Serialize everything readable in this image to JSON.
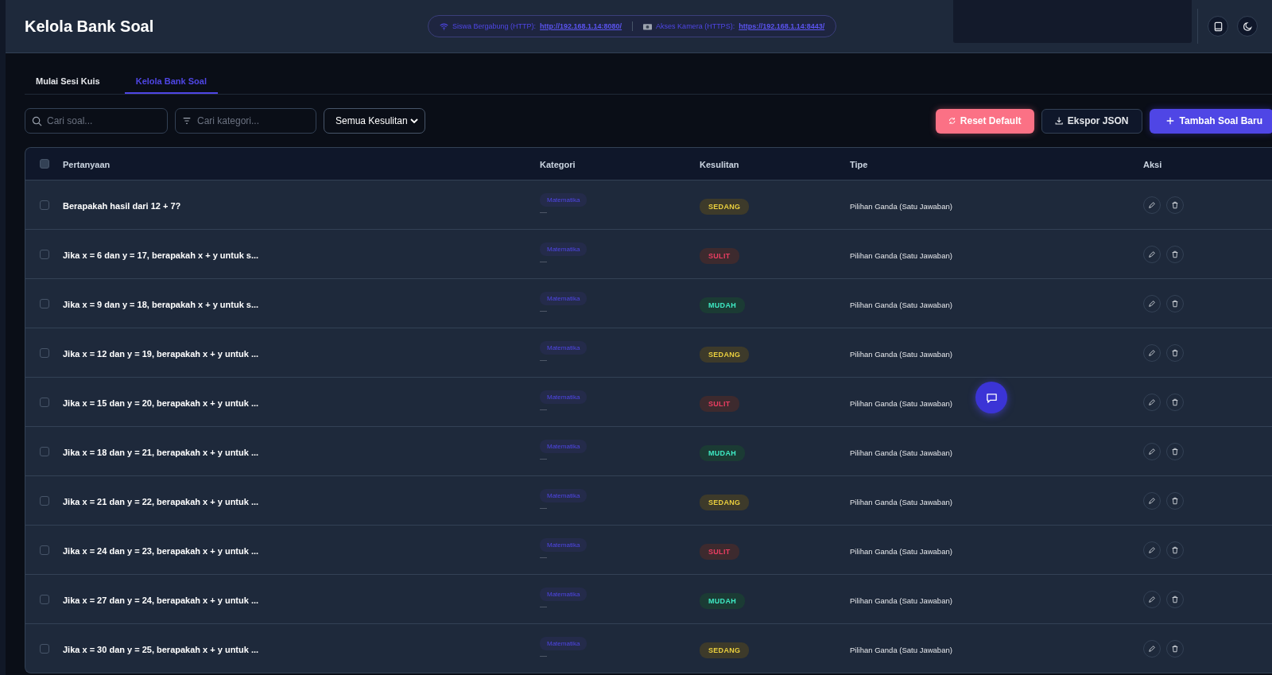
{
  "header": {
    "title": "Kelola Bank Soal",
    "connection": [
      {
        "kind": "wifi",
        "label": "Siswa Bergabung (HTTP):",
        "link": "http://192.168.1.14:8080/"
      },
      {
        "kind": "camera",
        "label": "Akses Kamera (HTTPS):",
        "link": "https://192.168.1.14:8443/"
      }
    ]
  },
  "tabs": [
    {
      "label": "Mulai Sesi Kuis",
      "selected": false
    },
    {
      "label": "Kelola Bank Soal",
      "selected": true
    }
  ],
  "filters": {
    "search": {
      "placeholder": "Cari soal..."
    },
    "category": {
      "placeholder": "Cari kategori..."
    },
    "difficulty": "Semua Kesulitan"
  },
  "actions": [
    {
      "kind": "reset",
      "label": "Reset Default"
    },
    {
      "kind": "export",
      "label": "Ekspor JSON"
    },
    {
      "kind": "add",
      "label": "Tambah Soal Baru"
    }
  ],
  "table": {
    "columns": [
      "Pertanyaan",
      "Kategori",
      "Kesulitan",
      "Tipe",
      "Aksi"
    ],
    "select_all": false,
    "rows": [
      {
        "checked": false,
        "question": "Berapakah hasil dari 12 + 7?",
        "category": "Matematika",
        "subcategory": "—",
        "difficulty": "SEDANG",
        "color": "#3d3a2a",
        "type": "Pilihan Ganda (Satu Jawaban)"
      },
      {
        "checked": false,
        "question": "Jika x = 6 dan y = 17, berapakah x + y untuk s...",
        "category": "Matematika",
        "subcategory": "—",
        "difficulty": "SULIT",
        "color": "#3d2a2e",
        "type": "Pilihan Ganda (Satu Jawaban)"
      },
      {
        "checked": false,
        "question": "Jika x = 9 dan y = 18, berapakah x + y untuk s...",
        "category": "Matematika",
        "subcategory": "—",
        "difficulty": "MUDAH",
        "color": "#1b3b34",
        "type": "Pilihan Ganda (Satu Jawaban)"
      },
      {
        "checked": false,
        "question": "Jika x = 12 dan y = 19, berapakah x + y untuk ...",
        "category": "Matematika",
        "subcategory": "—",
        "difficulty": "SEDANG",
        "color": "#3d3a2a",
        "type": "Pilihan Ganda (Satu Jawaban)"
      },
      {
        "checked": false,
        "question": "Jika x = 15 dan y = 20, berapakah x + y untuk ...",
        "category": "Matematika",
        "subcategory": "—",
        "difficulty": "SULIT",
        "color": "#3d2a2e",
        "type": "Pilihan Ganda (Satu Jawaban)"
      },
      {
        "checked": false,
        "question": "Jika x = 18 dan y = 21, berapakah x + y untuk ...",
        "category": "Matematika",
        "subcategory": "—",
        "difficulty": "MUDAH",
        "color": "#1b3b34",
        "type": "Pilihan Ganda (Satu Jawaban)"
      },
      {
        "checked": false,
        "question": "Jika x = 21 dan y = 22, berapakah x + y untuk ...",
        "category": "Matematika",
        "subcategory": "—",
        "difficulty": "SEDANG",
        "color": "#3d3a2a",
        "type": "Pilihan Ganda (Satu Jawaban)"
      },
      {
        "checked": false,
        "question": "Jika x = 24 dan y = 23, berapakah x + y untuk ...",
        "category": "Matematika",
        "subcategory": "—",
        "difficulty": "SULIT",
        "color": "#3d2a2e",
        "type": "Pilihan Ganda (Satu Jawaban)"
      },
      {
        "checked": false,
        "question": "Jika x = 27 dan y = 24, berapakah x + y untuk ...",
        "category": "Matematika",
        "subcategory": "—",
        "difficulty": "MUDAH",
        "color": "#1b3b34",
        "type": "Pilihan Ganda (Satu Jawaban)"
      },
      {
        "checked": false,
        "question": "Jika x = 30 dan y = 25, berapakah x + y untuk ...",
        "category": "Matematika",
        "subcategory": "—",
        "difficulty": "SEDANG",
        "color": "#3d3a2a",
        "type": "Pilihan Ganda (Satu Jawaban)"
      }
    ]
  }
}
